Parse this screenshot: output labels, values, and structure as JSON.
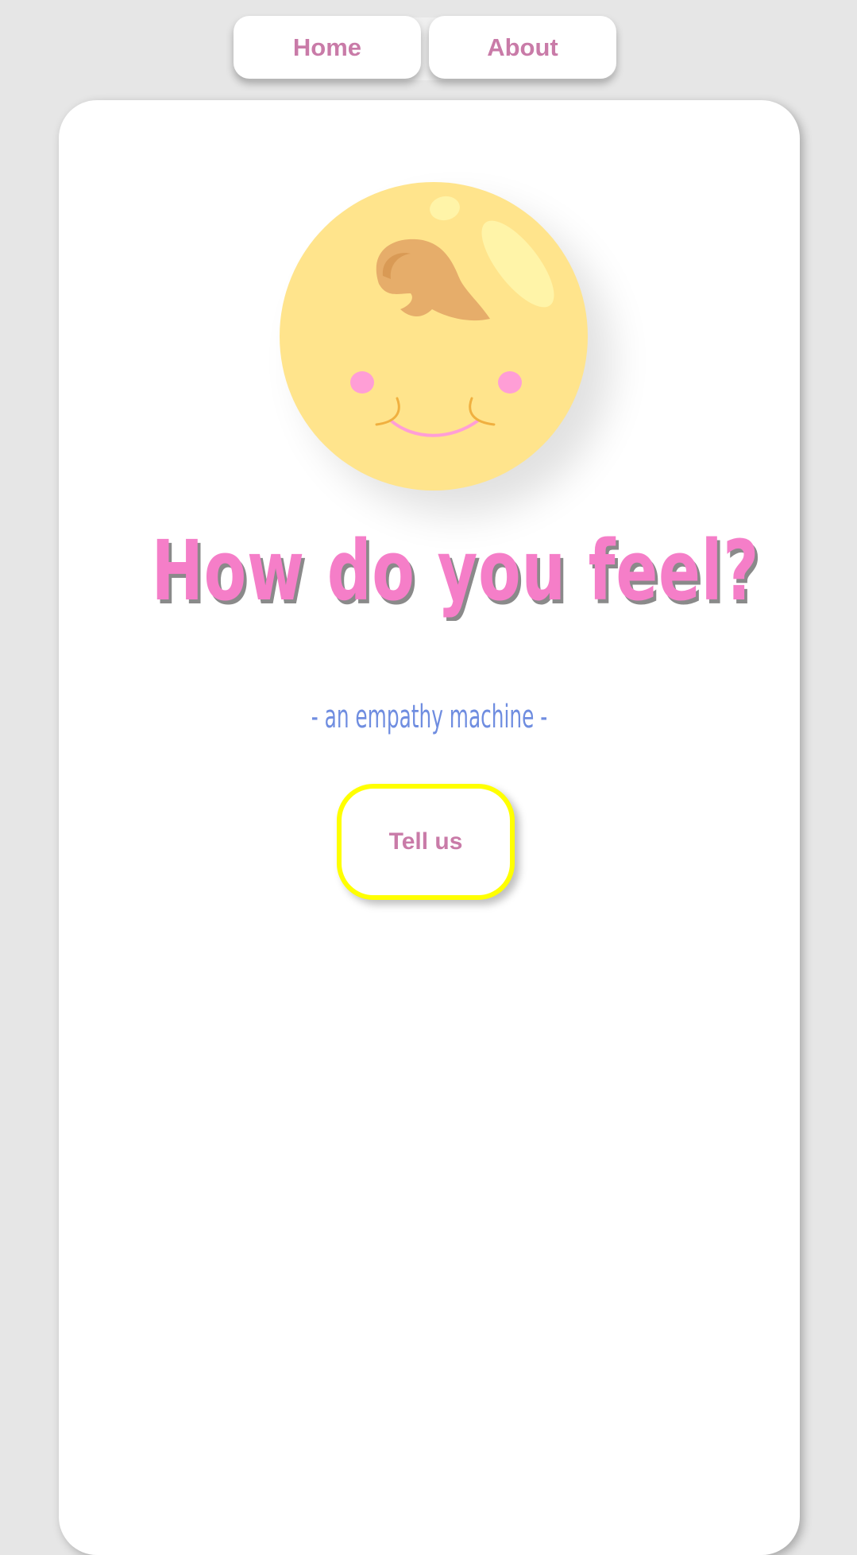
{
  "nav": {
    "items": [
      {
        "label": "Home"
      },
      {
        "label": "About"
      }
    ]
  },
  "hero": {
    "title": "How do you feel?",
    "subtitle": "- an empathy machine -",
    "cta_label": "Tell us"
  },
  "colors": {
    "background": "#e6e6e6",
    "card": "#ffffff",
    "title": "#f57ec8",
    "subtitle": "#6f8de0",
    "nav_text": "#c97ba8",
    "cta_border": "#ffff00",
    "face": "#ffe48c"
  },
  "icons": {
    "mascot": "smiling-baby-face-icon"
  }
}
